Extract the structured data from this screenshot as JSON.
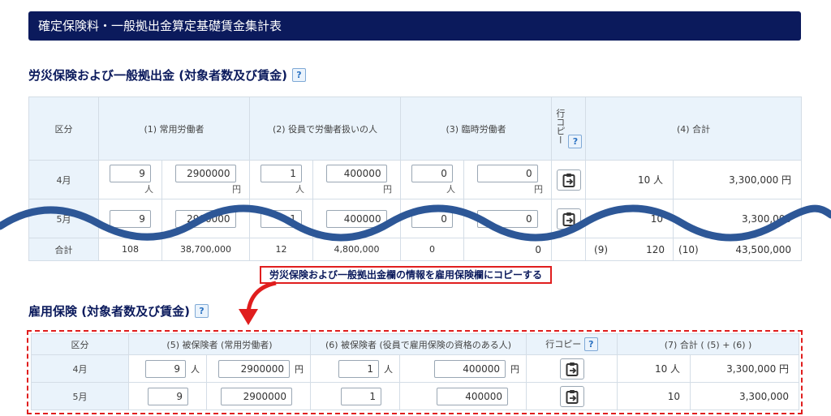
{
  "header": {
    "title": "確定保険料・一般拠出金算定基礎賃金集計表"
  },
  "section1": {
    "title": "労災保険および一般拠出金 (対象者数及び賃金)",
    "help": "?",
    "headers": {
      "kubun": "区分",
      "c1": "(1) 常用労働者",
      "c2": "(2) 役員で労働者扱いの人",
      "c3": "(3) 臨時労働者",
      "copy": "行コピー",
      "c4": "(4) 合計"
    },
    "units": {
      "person": "人",
      "yen": "円"
    },
    "rows": [
      {
        "label": "4月",
        "c1_count": "9",
        "c1_wage": "2900000",
        "c2_count": "1",
        "c2_wage": "400000",
        "c3_count": "0",
        "c3_wage": "0",
        "total_count": "10 人",
        "total_wage": "3,300,000 円"
      },
      {
        "label": "5月",
        "c1_count": "9",
        "c1_wage": "2900000",
        "c2_count": "1",
        "c2_wage": "400000",
        "c3_count": "0",
        "c3_wage": "0",
        "total_count": "10",
        "total_wage": "3,300,000"
      }
    ],
    "sum": {
      "label": "合計",
      "c1_count": "108",
      "c1_wage": "38,700,000",
      "c2_count": "12",
      "c2_wage": "4,800,000",
      "c3_count": "0",
      "c3_wage": "0",
      "tag9": "(9)",
      "total_count": "120",
      "tag10": "(10)",
      "total_wage": "43,500,000"
    }
  },
  "callout": {
    "text": "労災保険および一般拠出金欄の情報を雇用保険欄にコピーする"
  },
  "section2": {
    "title": "雇用保険 (対象者数及び賃金)",
    "help": "?",
    "headers": {
      "kubun": "区分",
      "c5": "(5) 被保険者 (常用労働者)",
      "c6": "(6) 被保険者 (役員で雇用保険の資格のある人)",
      "copy": "行コピー",
      "c7": "(7) 合計 ( (5) + (6) )"
    },
    "units": {
      "person": "人",
      "yen": "円"
    },
    "rows": [
      {
        "label": "4月",
        "c5_count": "9",
        "c5_wage": "2900000",
        "c6_count": "1",
        "c6_wage": "400000",
        "total_count": "10 人",
        "total_wage": "3,300,000 円"
      },
      {
        "label": "5月",
        "c5_count": "9",
        "c5_wage": "2900000",
        "c6_count": "1",
        "c6_wage": "400000",
        "total_count": "10",
        "total_wage": "3,300,000"
      }
    ]
  },
  "colors": {
    "header_bg": "#0b1a5c",
    "accent_red": "#e01e1e",
    "wave": "#2d5797"
  }
}
